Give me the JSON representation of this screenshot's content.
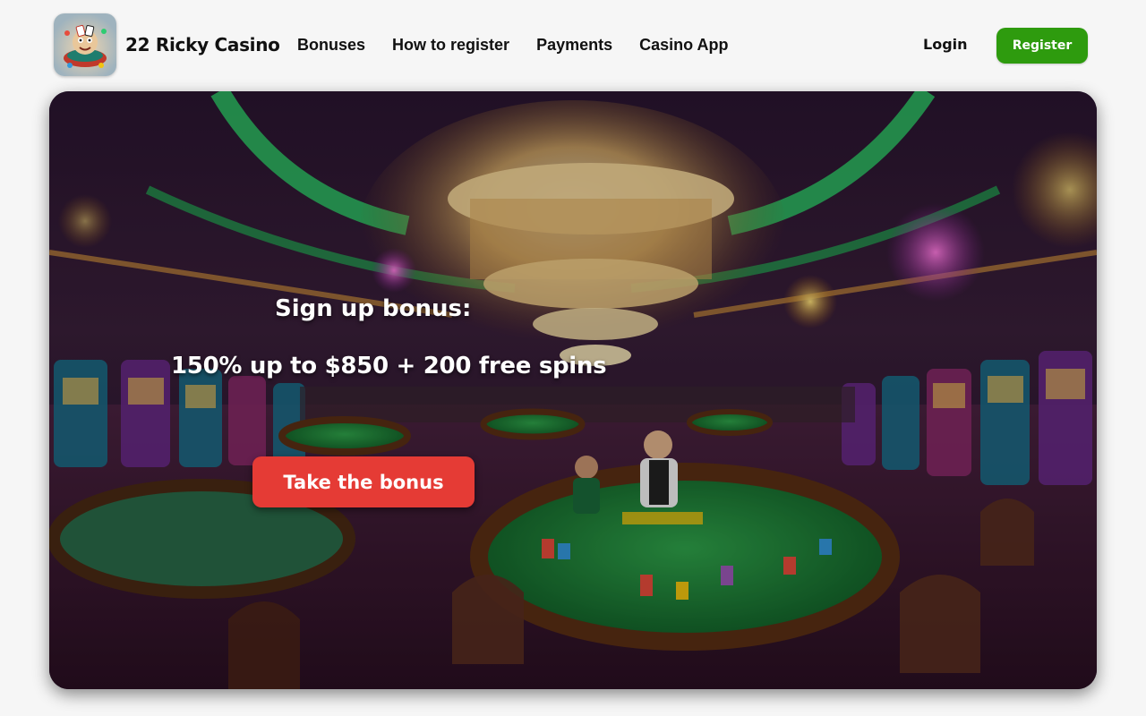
{
  "header": {
    "brand": "22 Ricky Casino",
    "nav": [
      {
        "label": "Bonuses"
      },
      {
        "label": "How to register"
      },
      {
        "label": "Payments"
      },
      {
        "label": "Casino App"
      }
    ],
    "login": "Login",
    "register": "Register"
  },
  "hero": {
    "title": "Sign up bonus:",
    "offer": "150% up to $850 + 200 free spins",
    "cta": "Take the bonus"
  },
  "colors": {
    "register_green": "#2e9b0e",
    "cta_red": "#e53b35"
  },
  "icons": {
    "logo": "casino-mascot-logo"
  }
}
